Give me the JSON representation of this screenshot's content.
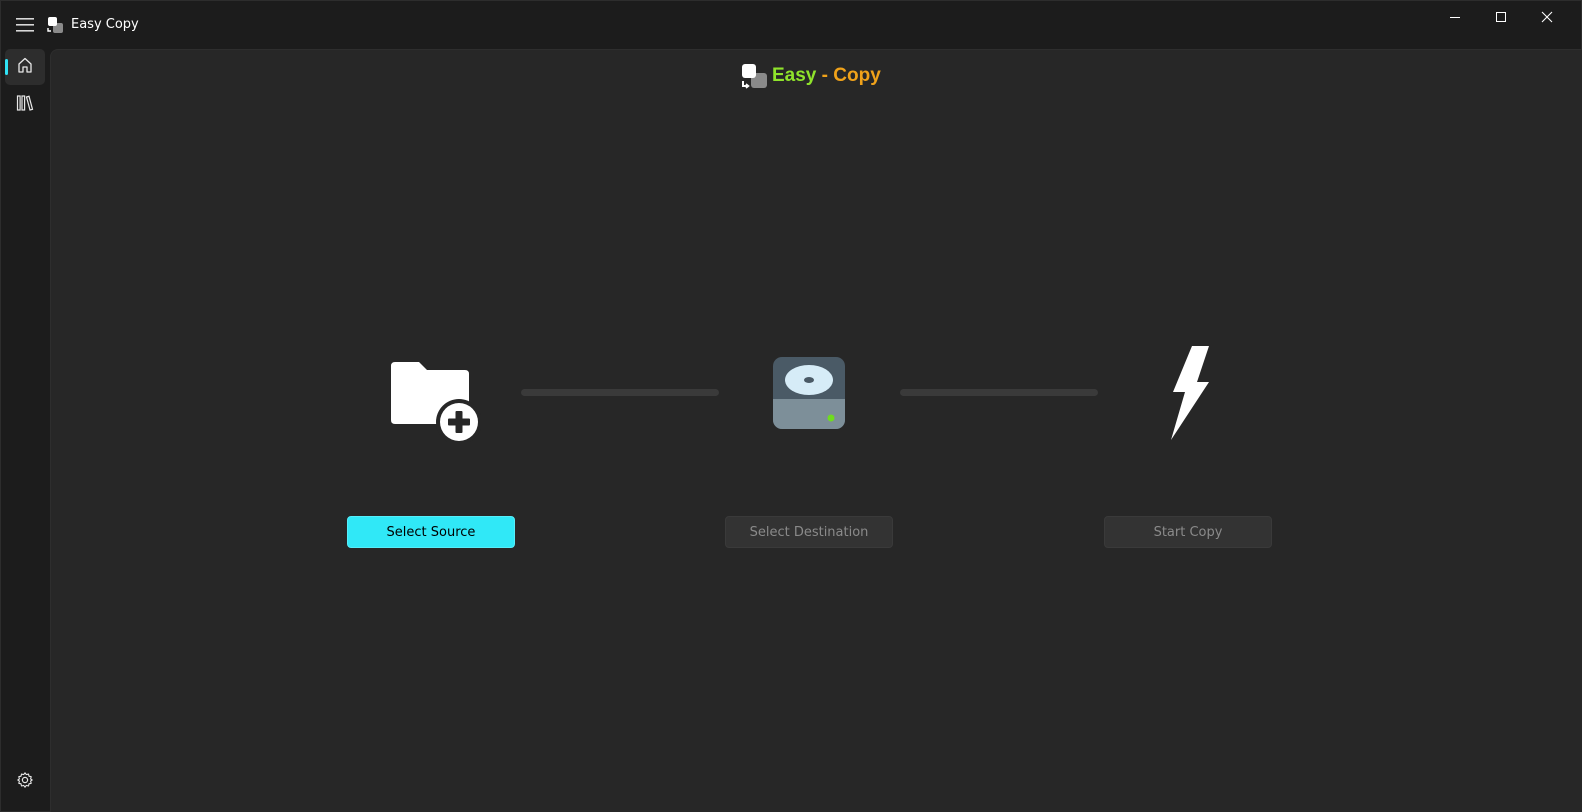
{
  "window": {
    "title": "Easy Copy"
  },
  "titlebar": {
    "menu_icon": "hamburger-icon",
    "app_icon": "easy-copy-logo-icon",
    "controls": [
      "minimize-icon",
      "maximize-icon",
      "close-icon"
    ]
  },
  "nav": {
    "items": [
      {
        "name": "home",
        "icon": "home-icon",
        "selected": true
      },
      {
        "name": "library",
        "icon": "library-icon",
        "selected": false
      }
    ],
    "footer": {
      "name": "settings",
      "icon": "gear-icon"
    }
  },
  "brand": {
    "easy": "Easy",
    "separator": " - ",
    "copy": "Copy"
  },
  "steps": [
    {
      "icon": "folder-add-icon",
      "button_label": "Select Source",
      "enabled": true
    },
    {
      "icon": "hard-drive-icon",
      "button_label": "Select Destination",
      "enabled": false
    },
    {
      "icon": "lightning-bolt-icon",
      "button_label": "Start Copy",
      "enabled": false
    }
  ],
  "colors": {
    "accent": "#30e8f7",
    "brand_green": "#8fe32b",
    "brand_orange": "#f0a21a",
    "background": "#272727",
    "chrome": "#1c1c1c"
  }
}
